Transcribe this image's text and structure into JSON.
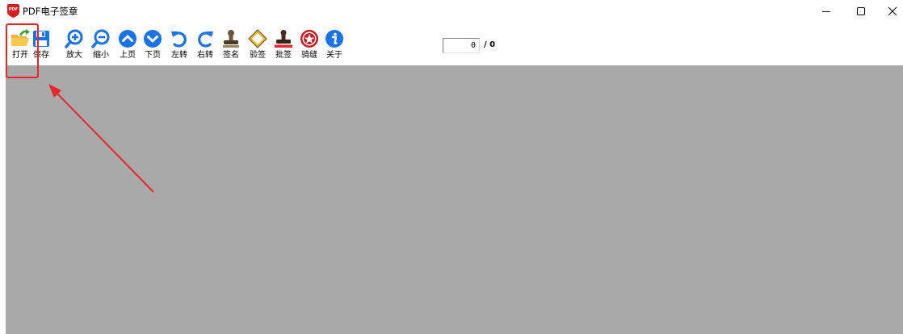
{
  "window": {
    "title": "PDF电子签章",
    "app_icon_text": "PDF",
    "buttons": [
      "minimize",
      "maximize",
      "close"
    ]
  },
  "toolbar": {
    "items": [
      {
        "label": "打开",
        "icon": "open-folder-icon"
      },
      {
        "label": "保存",
        "icon": "save-disk-icon"
      },
      {
        "label": "放大",
        "icon": "zoom-in-icon"
      },
      {
        "label": "缩小",
        "icon": "zoom-out-icon"
      },
      {
        "label": "上页",
        "icon": "page-up-icon"
      },
      {
        "label": "下页",
        "icon": "page-down-icon"
      },
      {
        "label": "左转",
        "icon": "rotate-left-icon"
      },
      {
        "label": "右转",
        "icon": "rotate-right-icon"
      },
      {
        "label": "签名",
        "icon": "stamp-sign-icon"
      },
      {
        "label": "验签",
        "icon": "verify-diamond-icon"
      },
      {
        "label": "批签",
        "icon": "batch-stamp-icon"
      },
      {
        "label": "骑缝",
        "icon": "seam-seal-icon"
      },
      {
        "label": "关于",
        "icon": "info-icon"
      }
    ]
  },
  "pager": {
    "current_page": "0",
    "separator_total": "/ 0"
  },
  "colors": {
    "accent_blue": "#1a73e8",
    "document_background": "#a9a9a9",
    "annotation_red": "#e6262b"
  }
}
